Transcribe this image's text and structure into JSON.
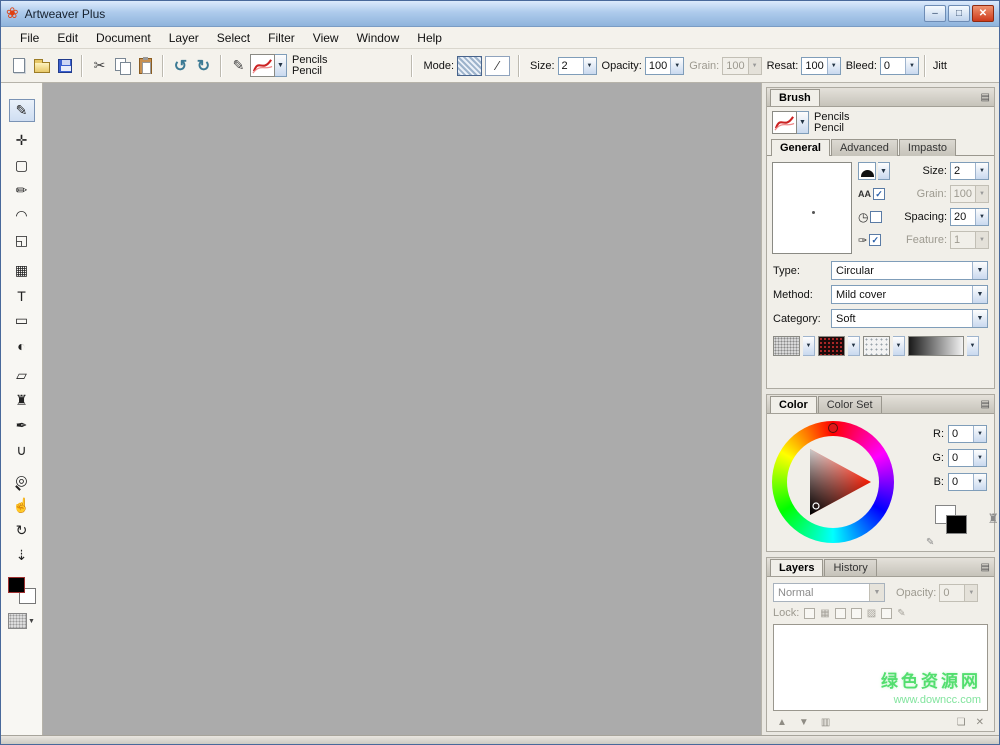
{
  "window": {
    "title": "Artweaver Plus"
  },
  "menu": {
    "items": [
      "File",
      "Edit",
      "Document",
      "Layer",
      "Select",
      "Filter",
      "View",
      "Window",
      "Help"
    ]
  },
  "toolbar": {
    "brush_name": "Pencils",
    "brush_variant": "Pencil",
    "mode_label": "Mode:",
    "size_label": "Size:",
    "size_value": "2",
    "opacity_label": "Opacity:",
    "opacity_value": "100",
    "grain_label": "Grain:",
    "grain_value": "100",
    "resat_label": "Resat:",
    "resat_value": "100",
    "bleed_label": "Bleed:",
    "bleed_value": "0",
    "jitter_label": "Jitt"
  },
  "brush_panel": {
    "title": "Brush",
    "brush_name": "Pencils",
    "brush_variant": "Pencil",
    "tabs": [
      "General",
      "Advanced",
      "Impasto"
    ],
    "size_label": "Size:",
    "size_value": "2",
    "grain_label": "Grain:",
    "grain_value": "100",
    "spacing_label": "Spacing:",
    "spacing_value": "20",
    "feature_label": "Feature:",
    "feature_value": "1",
    "type_label": "Type:",
    "type_value": "Circular",
    "method_label": "Method:",
    "method_value": "Mild cover",
    "category_label": "Category:",
    "category_value": "Soft"
  },
  "color_panel": {
    "tabs": [
      "Color",
      "Color Set"
    ],
    "r_label": "R:",
    "r_value": "0",
    "g_label": "G:",
    "g_value": "0",
    "b_label": "B:",
    "b_value": "0"
  },
  "layers_panel": {
    "tabs": [
      "Layers",
      "History"
    ],
    "blend_mode": "Normal",
    "opacity_label": "Opacity:",
    "opacity_value": "0",
    "lock_label": "Lock:"
  },
  "watermark": {
    "line1": "绿色资源网",
    "line2": "www.downcc.com"
  },
  "icons": {
    "logo": "❀",
    "minimize": "–",
    "maximize": "□",
    "close": "✕",
    "cut": "✂",
    "undo": "↺",
    "redo": "↻",
    "pencil": "✎",
    "dropdown": "▼",
    "panel_menu": "▤",
    "mode_line": "∕",
    "aa": "AA",
    "clock": "◷",
    "brush_check": "✑",
    "tool_paint": "✎",
    "tool_move": "✛",
    "tool_select": "▢",
    "tool_pencil": "✏",
    "tool_lasso": "◠",
    "tool_crop": "◱",
    "tool_pattern": "▦",
    "tool_text": "T",
    "tool_shape": "▭",
    "tool_gradient": "◐",
    "tool_eraser": "▱",
    "tool_stamp": "♜",
    "tool_knife": "✒",
    "tool_fill": "∪",
    "tool_zoom": "◎",
    "tool_hand": "☝",
    "tool_rotate": "↻",
    "tool_picker": "⇣",
    "arrow_up": "▲",
    "arrow_down": "▼",
    "layer_folder": "▥",
    "layer_new": "❏",
    "layer_delete": "✕",
    "lock_checker": "▦",
    "lock_image": "▨",
    "lock_brush": "✎",
    "brush_small": "✎",
    "stamp_small": "♜"
  },
  "colors": {
    "canvas_gray": "#ababab",
    "titlebar_blue": "#aecbec",
    "close_red": "#cd3a1c",
    "watermark_green": "#52de6e"
  }
}
